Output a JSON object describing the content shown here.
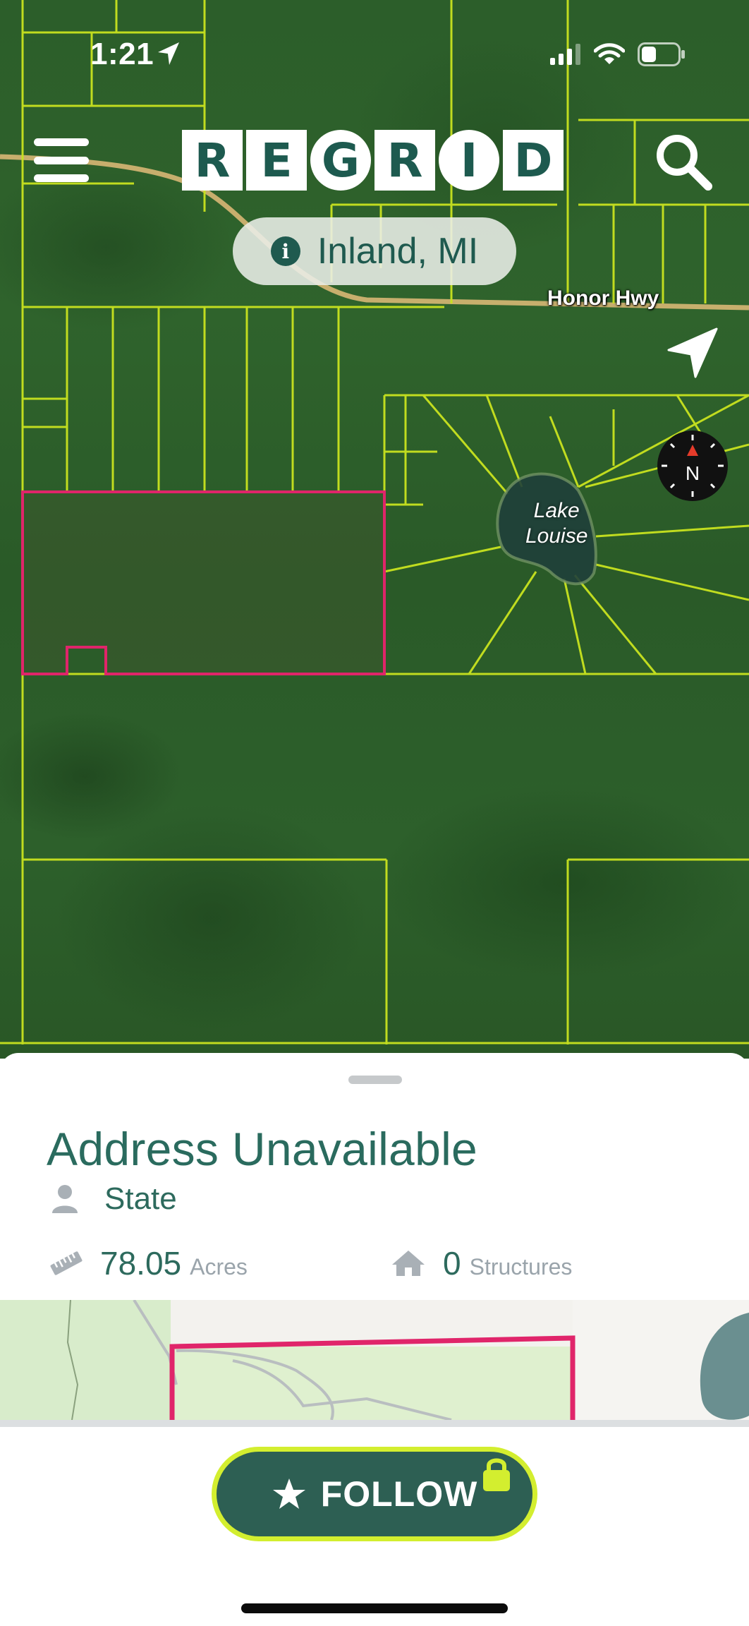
{
  "status_bar": {
    "time": "1:21",
    "icons": [
      "location-arrow-icon",
      "cellular-signal-icon",
      "wifi-icon",
      "battery-icon"
    ]
  },
  "header": {
    "menu_icon": "hamburger-menu-icon",
    "logo_letters": [
      "R",
      "E",
      "G",
      "R",
      "I",
      "D"
    ],
    "search_icon": "search-icon"
  },
  "location_pill": {
    "icon": "info-icon",
    "info_glyph": "i",
    "text": "Inland, MI"
  },
  "map": {
    "road_label": "Honor Hwy",
    "lake_label_line1": "Lake",
    "lake_label_line2": "Louise",
    "compass_label": "N",
    "locate_icon": "navigation-arrow-icon",
    "colors": {
      "parcel_line": "#c9e31f",
      "selected_parcel": "#e0256a"
    }
  },
  "parcel_sheet": {
    "address": "Address Unavailable",
    "owner_icon": "person-icon",
    "owner": "State",
    "area_icon": "ruler-icon",
    "acres_value": "78.05",
    "acres_unit": "Acres",
    "structures_icon": "house-icon",
    "structures_value": "0",
    "structures_unit": "Structures"
  },
  "follow_button": {
    "icon": "star-icon",
    "label": "FOLLOW",
    "badge_icon": "lock-icon",
    "colors": {
      "background": "#2d5f53",
      "border": "#d3ee2f"
    }
  }
}
